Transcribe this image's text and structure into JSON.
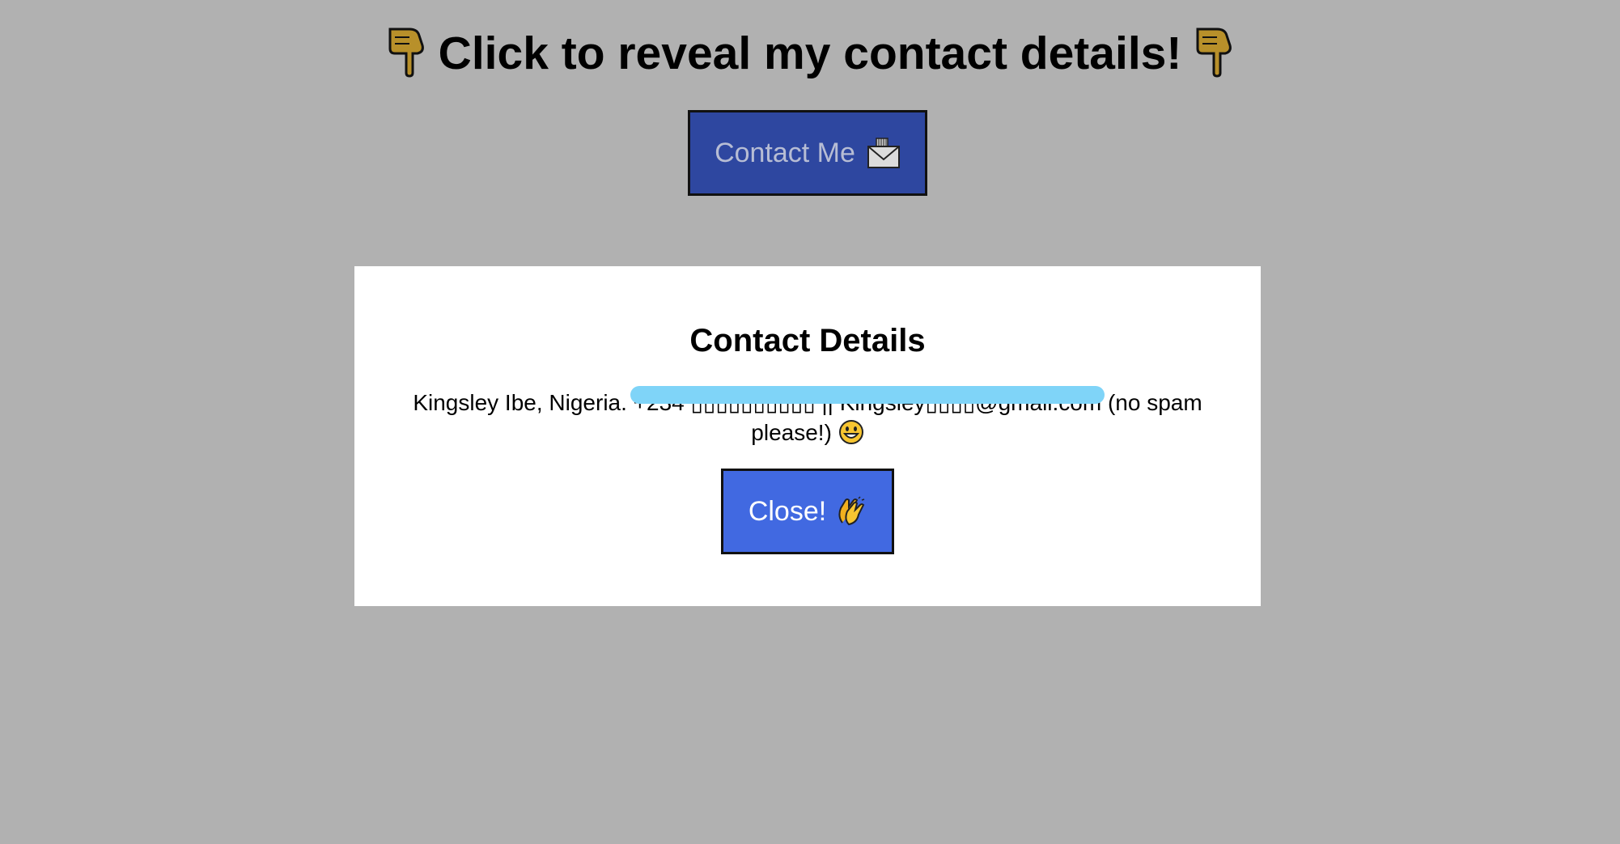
{
  "header": {
    "title": "Click to reveal my contact details!",
    "left_icon": "pointing-down-hand-icon",
    "right_icon": "pointing-down-hand-icon"
  },
  "contact_button": {
    "label": "Contact Me",
    "icon": "envelope-icon"
  },
  "modal": {
    "title": "Contact Details",
    "text_prefix": "Kingsley Ibe, Nigeria.",
    "redacted_text": "+234 ▯▯▯▯▯▯▯▯▯▯ || Kingsley▯▯▯▯@gmail.com",
    "text_suffix": "(no spam please!)",
    "text_icon": "grinning-face-icon",
    "close_button": {
      "label": "Close!",
      "icon": "clapping-hands-icon"
    }
  },
  "colors": {
    "page_background": "#b1b1b1",
    "contact_button_bg": "#2e47a0",
    "close_button_bg": "#4169e1",
    "redaction": "#7fd4f8",
    "modal_bg": "#ffffff"
  }
}
